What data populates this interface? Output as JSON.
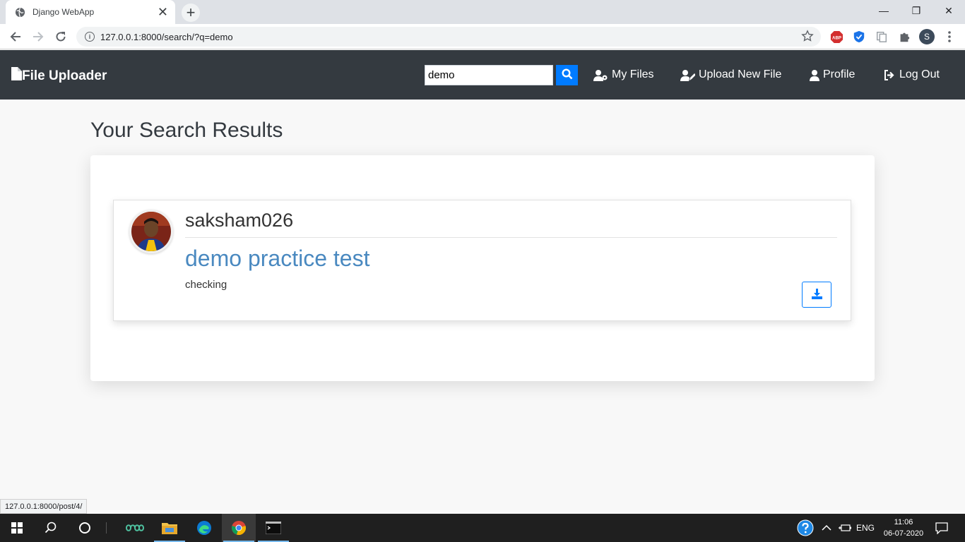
{
  "browser": {
    "tab_title": "Django WebApp",
    "tab_close": "✕",
    "new_tab": "+",
    "url": "127.0.0.1:8000/search/?q=demo",
    "info_glyph": "i",
    "profile_initial": "S",
    "abp_label": "ABP",
    "window_controls": {
      "minimize": "—",
      "restore": "❐",
      "close": "✕"
    }
  },
  "navbar": {
    "brand": "File Uploader",
    "search_value": "demo",
    "links": {
      "my_files": "My Files",
      "upload": "Upload New File",
      "profile": "Profile",
      "logout": "Log Out"
    }
  },
  "main": {
    "title": "Your Search Results",
    "results": [
      {
        "username": "saksham026",
        "title": "demo practice test",
        "description": "checking"
      }
    ]
  },
  "status_url": "127.0.0.1:8000/post/4/",
  "taskbar": {
    "language": "ENG",
    "time": "11:06",
    "date": "06-07-2020"
  },
  "colors": {
    "navbar_bg": "#343a40",
    "accent": "#007bff",
    "post_title": "#4a89c0",
    "page_bg": "#f8f8f8"
  }
}
